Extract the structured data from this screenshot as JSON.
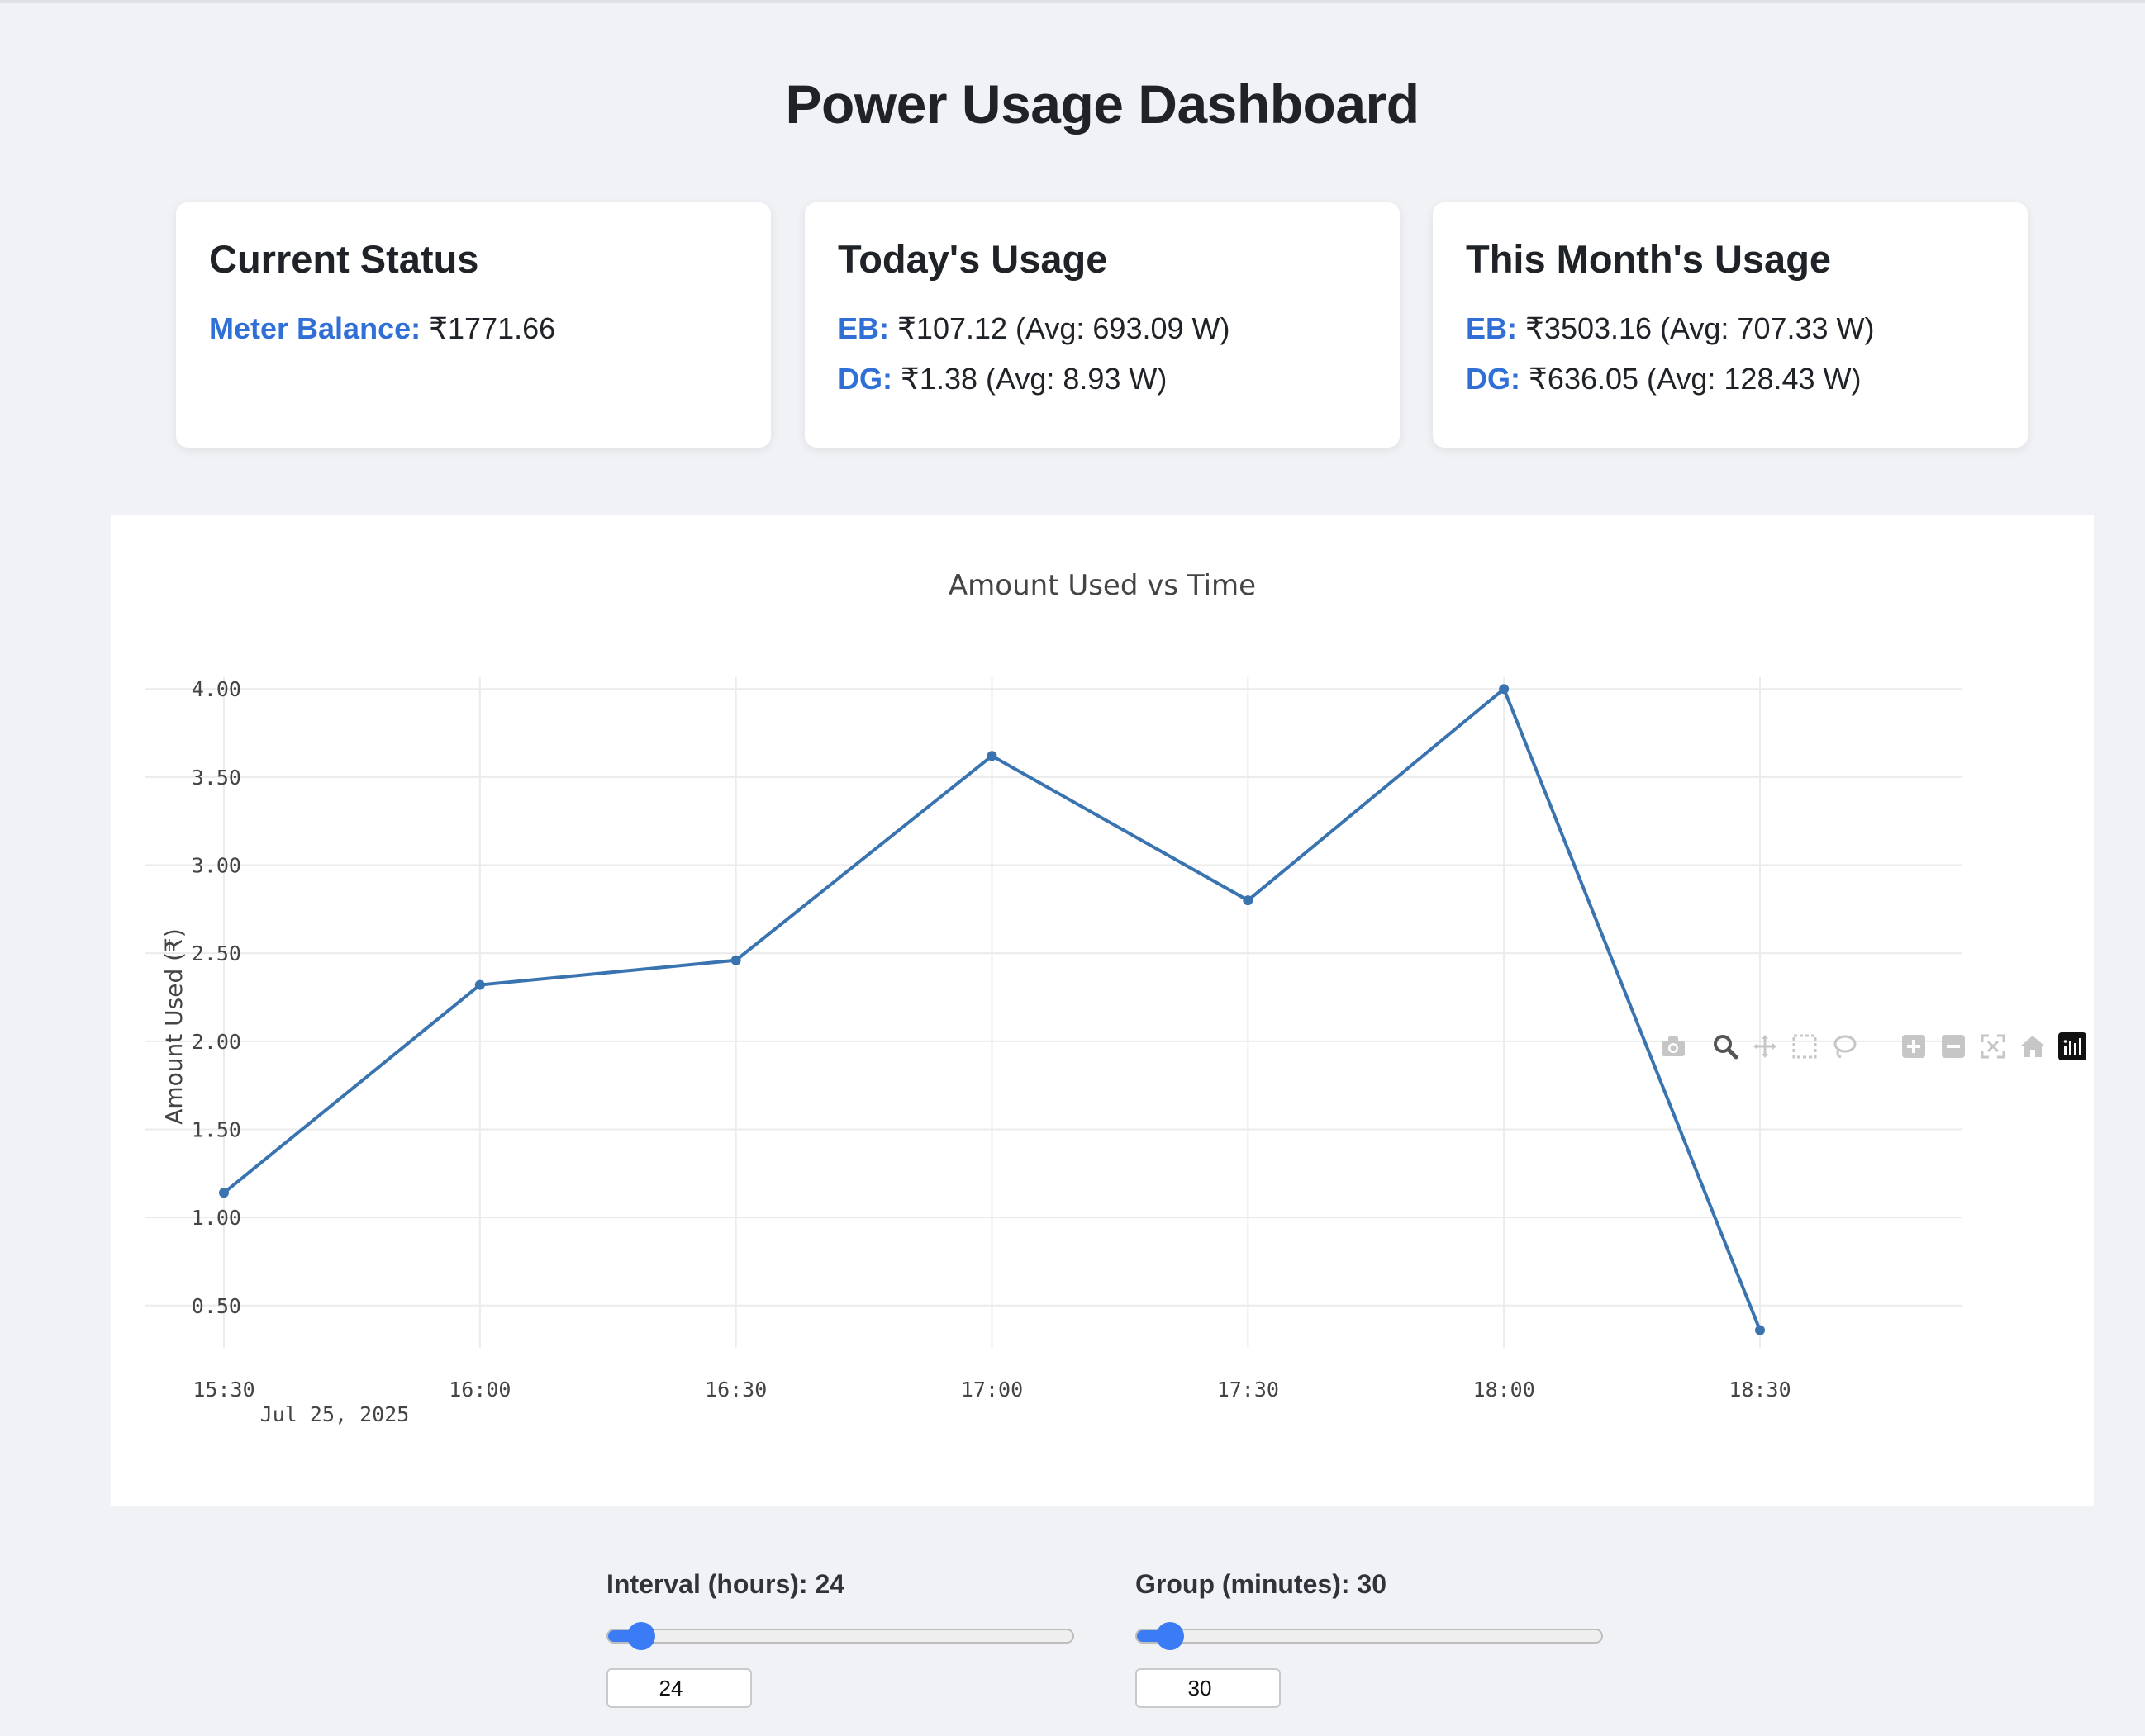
{
  "page": {
    "title": "Power Usage Dashboard"
  },
  "cards": {
    "current_status": {
      "title": "Current Status",
      "meter_balance_label": "Meter Balance:",
      "meter_balance_value": "₹1771.66"
    },
    "today": {
      "title": "Today's Usage",
      "eb_label": "EB:",
      "eb_value": "₹107.12 (Avg: 693.09 W)",
      "dg_label": "DG:",
      "dg_value": "₹1.38 (Avg: 8.93 W)"
    },
    "month": {
      "title": "This Month's Usage",
      "eb_label": "EB:",
      "eb_value": "₹3503.16 (Avg: 707.33 W)",
      "dg_label": "DG:",
      "dg_value": "₹636.05 (Avg: 128.43 W)"
    }
  },
  "modebar": {
    "icons": [
      "camera-icon",
      "zoom-icon",
      "pan-icon",
      "box-select-icon",
      "lasso-select-icon",
      "zoom-in-icon",
      "zoom-out-icon",
      "autoscale-icon",
      "reset-axes-icon",
      "plotly-logo-icon"
    ]
  },
  "chart_data": {
    "type": "line",
    "title": "Amount Used vs Time",
    "xlabel": "",
    "ylabel": "Amount Used (₹)",
    "x": [
      "15:30",
      "16:00",
      "16:30",
      "17:00",
      "17:30",
      "18:00",
      "18:30"
    ],
    "x_sublabel": "Jul 25, 2025",
    "values": [
      1.14,
      2.32,
      2.46,
      3.62,
      2.8,
      4.0,
      0.36
    ],
    "ylim": [
      0.26,
      4.24
    ],
    "yticks": [
      "0.50",
      "1.00",
      "1.50",
      "2.00",
      "2.50",
      "3.00",
      "3.50",
      "4.00"
    ],
    "ytick_values": [
      0.5,
      1.0,
      1.5,
      2.0,
      2.5,
      3.0,
      3.5,
      4.0
    ],
    "grid": true,
    "line_color": "#3a74b0"
  },
  "controls": {
    "interval": {
      "label": "Interval (hours): 24",
      "value": "24",
      "level": 0.04
    },
    "group": {
      "label": "Group (minutes): 30",
      "value": "30",
      "level": 0.04
    }
  }
}
